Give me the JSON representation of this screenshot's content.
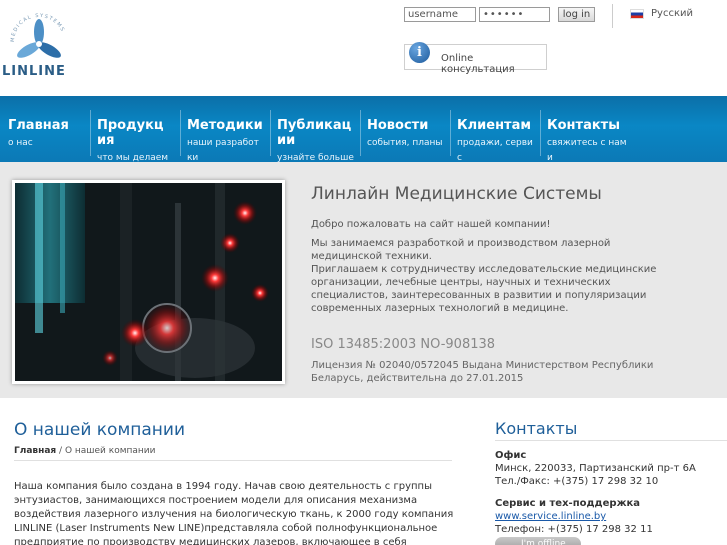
{
  "header": {
    "logo_text": "LINLINE",
    "logo_arc_text": "MEDICAL SYSTEMS",
    "login": {
      "username_value": "username",
      "password_value": "••••••",
      "button_label": "log in"
    },
    "language": "Русский",
    "consult_label": "Online консультация"
  },
  "nav": {
    "items": [
      {
        "title": "Главная",
        "sub": "о нас"
      },
      {
        "title": "Продукция",
        "sub": "что мы делаем"
      },
      {
        "title": "Методики",
        "sub": "наши разработки"
      },
      {
        "title": "Публикации",
        "sub": "узнайте больше"
      },
      {
        "title": "Новости",
        "sub": "события, планы"
      },
      {
        "title": "Клиентам",
        "sub": "продажи, сервис"
      },
      {
        "title": "Контакты",
        "sub": "свяжитесь с нами"
      }
    ]
  },
  "hero": {
    "title": "Линлайн Медицинские Системы",
    "welcome": "Добро пожаловать на сайт нашей компании!",
    "p1": "Мы занимаемся разработкой и производством лазерной медицинской техники.",
    "p2": "Приглашаем к сотрудничеству исследовательские медицинские организации, лечебные центры, научных и технических специалистов, заинтересованных в развитии и популяризации современных лазерных технологий в медицине.",
    "iso": "ISO 13485:2003 NO-908138",
    "license": "Лицензия № 02040/0572045  Выдана Министерством Республики Беларусь, действительна до 27.01.2015"
  },
  "about": {
    "title": "О нашей компании",
    "breadcrumb_home": "Главная",
    "breadcrumb_sep": " / ",
    "breadcrumb_current": "О нашей компании",
    "text": "Наша компания было создана в 1994 году. Начав свою деятельность с группы энтузиастов, занимающихся построением модели для описания механизма воздействия лазерного излучения на биологическую ткань, к 2000 году компания LINLINE (Laser Instruments New LINE)представляла собой полнофункциональное предприятие по производству медицинских лазеров, включающее в себя"
  },
  "contacts": {
    "title": "Контакты",
    "office_heading": "Офис",
    "office_address": "Минск, 220033, Партизанский пр-т 6А",
    "office_phone": "Тел./Факс: +(375) 17 298 32 10",
    "service_heading": "Сервис и тех-поддержка",
    "service_link": "www.service.linline.by",
    "service_phone": "Телефон: +(375) 17 298 32 11",
    "status_badge": "I'm offline"
  }
}
